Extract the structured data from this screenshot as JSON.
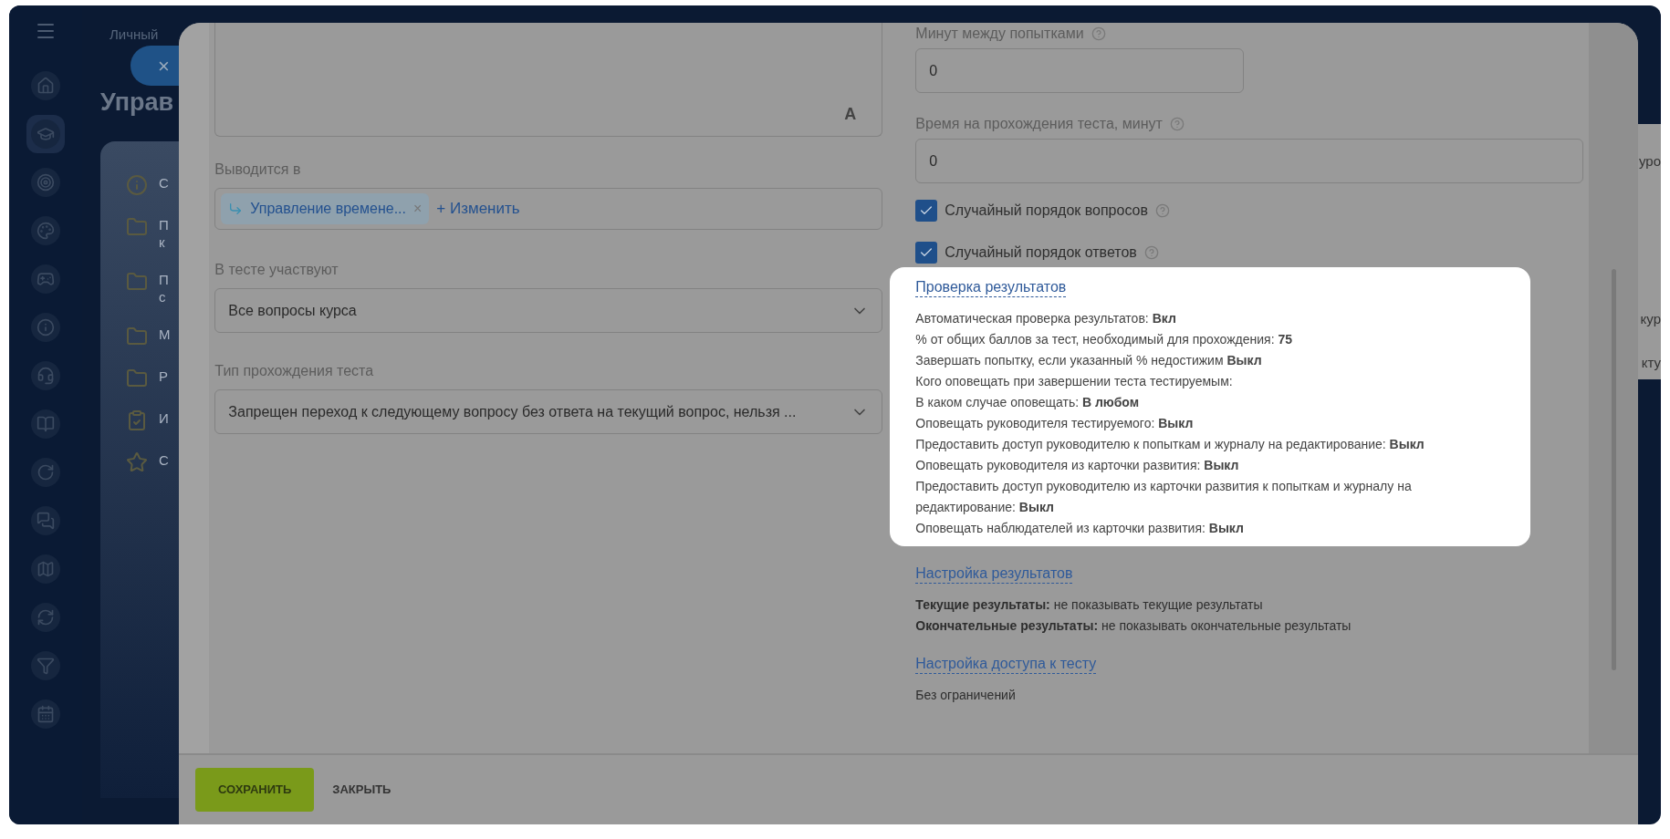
{
  "sidebar": {
    "items": [
      {
        "selected": false
      },
      {
        "selected": true
      },
      {
        "selected": false
      },
      {
        "selected": false
      },
      {
        "selected": false
      },
      {
        "selected": false
      },
      {
        "selected": false
      },
      {
        "selected": false
      },
      {
        "selected": false
      },
      {
        "selected": false
      },
      {
        "selected": false
      },
      {
        "selected": false
      },
      {
        "selected": false
      },
      {
        "selected": false
      }
    ]
  },
  "background": {
    "top_label": "Личный",
    "close_symbol": "×",
    "heading": "Управ",
    "card_items": [
      {
        "kind": "info",
        "lines": [
          "С"
        ]
      },
      {
        "kind": "folder",
        "lines": [
          "П",
          "к"
        ]
      },
      {
        "kind": "folder",
        "lines": [
          "П",
          "с"
        ]
      },
      {
        "kind": "folder",
        "lines": [
          "М"
        ]
      },
      {
        "kind": "folder",
        "lines": [
          "Р"
        ]
      },
      {
        "kind": "clipboard",
        "lines": [
          "И"
        ]
      },
      {
        "kind": "star",
        "lines": [
          "С"
        ]
      }
    ],
    "right_fragments": [
      "уро",
      "кур",
      "кту"
    ]
  },
  "modal": {
    "left": {
      "textarea_mark": "A",
      "output_field": {
        "label": "Выводится в",
        "tag": "Управление времене...",
        "tag_remove": "×",
        "change_link": "+ Изменить"
      },
      "participants": {
        "label": "В тесте участвуют",
        "value": "Все вопросы курса"
      },
      "pass_type": {
        "label": "Тип прохождения теста",
        "value": "Запрещен переход к следующему вопросу без ответа на текущий вопрос, нельзя ..."
      }
    },
    "right": {
      "minutes_between": {
        "label": "Минут между попытками",
        "value": "0"
      },
      "time_limit": {
        "label": "Время на прохождения теста, минут",
        "value": "0"
      },
      "checkboxes": [
        {
          "label": "Случайный порядок вопросов",
          "checked": true
        },
        {
          "label": "Случайный порядок ответов",
          "checked": true
        }
      ],
      "results_check": {
        "title": "Проверка результатов",
        "highlighted": true,
        "lines": [
          "Автоматическая проверка результатов: **Вкл**",
          "% от общих баллов за тест, необходимый для прохождения: **75**",
          "Завершать попытку, если указанный % недостижим **Выкл**",
          "Кого оповещать при завершении теста тестируемым:",
          "В каком случае оповещать: **В любом**",
          "Оповещать руководителя тестируемого: **Выкл**",
          "Предоставить доступ руководителю к попыткам и журналу на редактирование: **Выкл**",
          "Оповещать руководителя из карточки развития: **Выкл**",
          "Предоставить доступ руководителю из карточки развития к попыткам и журналу на редактирование: **Выкл**",
          "Оповещать наблюдателей из карточки развития: **Выкл**"
        ]
      },
      "results_settings": {
        "title": "Настройка результатов",
        "highlighted": false,
        "lines": [
          "**Текущие результаты:** не показывать текущие результаты",
          "**Окончательные результаты:** не показывать окончательные результаты"
        ]
      },
      "access_settings": {
        "title": "Настройка доступа к тесту",
        "highlighted": false,
        "lines": [
          "Без ограничений"
        ]
      }
    },
    "footer": {
      "save": "СОХРАНИТЬ",
      "close": "ЗАКРЫТЬ"
    }
  }
}
